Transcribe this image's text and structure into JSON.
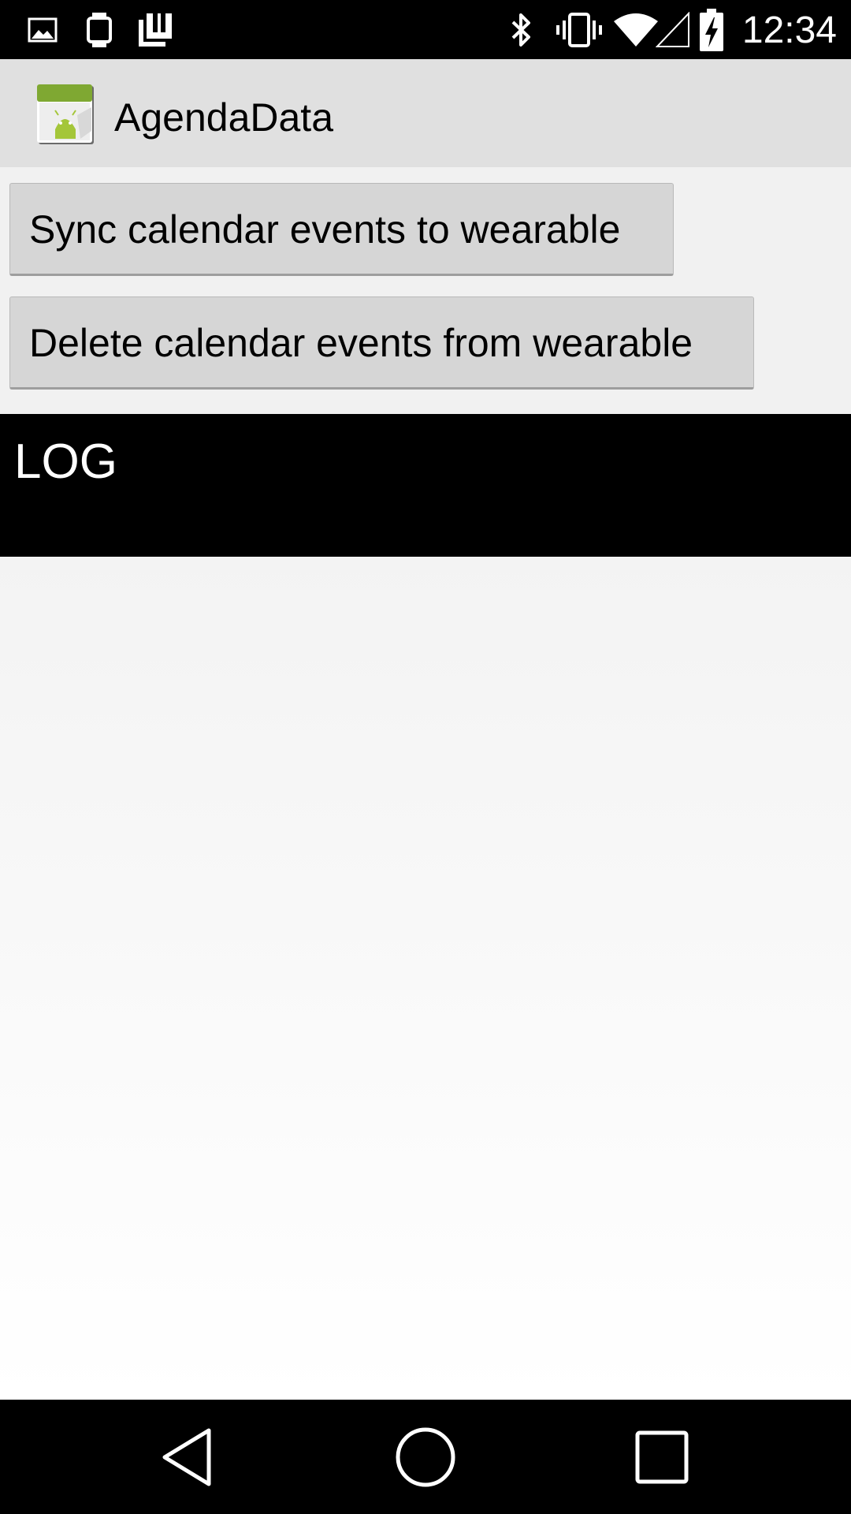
{
  "status_bar": {
    "time": "12:34",
    "icons": [
      "image-notification-icon",
      "watch-icon",
      "storage-notification-icon",
      "bluetooth-icon",
      "vibrate-icon",
      "wifi-icon",
      "cell-signal-icon",
      "battery-charging-icon"
    ]
  },
  "action_bar": {
    "title": "AgendaData",
    "icon": "android-app-icon"
  },
  "main": {
    "sync_button_label": "Sync calendar events to wearable",
    "delete_button_label": "Delete calendar events from wearable",
    "log_label": "LOG"
  },
  "nav_bar": {
    "icons": [
      "back-icon",
      "home-icon",
      "recents-icon"
    ]
  },
  "colors": {
    "action_bar_bg": "#e0e0e0",
    "button_bg": "#d6d6d6",
    "log_bg": "#000000",
    "app_icon_green": "#a4c639"
  }
}
